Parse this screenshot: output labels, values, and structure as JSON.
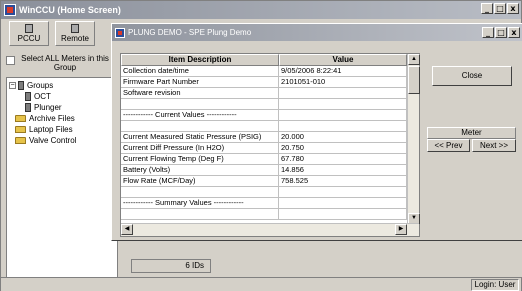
{
  "main_window": {
    "title": "WinCCU  (Home Screen)",
    "min": "_",
    "max": "□",
    "close": "x"
  },
  "toolbar": {
    "pccu_label": "PCCU",
    "remote_label": "Remote"
  },
  "select_all": {
    "label": "Select ALL Meters in this Group"
  },
  "tree": {
    "groups": "Groups",
    "oct": "OCT",
    "plunger": "Plunger",
    "archive": "Archive Files",
    "laptop": "Laptop Files",
    "valve": "Valve Control"
  },
  "child_window": {
    "title": "PLUNG DEMO - SPE Plung Demo",
    "min": "_",
    "max": "□",
    "close": "x"
  },
  "grid": {
    "headers": [
      "Item Description",
      "Value"
    ],
    "rows": [
      [
        "Collection date/time",
        "9/05/2006  8:22:41"
      ],
      [
        "Firmware Part Number",
        "2101051-010"
      ],
      [
        "Software revision",
        ""
      ],
      [
        "",
        ""
      ],
      [
        "------------ Current Values ------------",
        ""
      ],
      [
        "",
        ""
      ],
      [
        "Current Measured Static Pressure (PSIG)",
        "20.000"
      ],
      [
        "Current Diff Pressure (In H2O)",
        "20.750"
      ],
      [
        "Current Flowing Temp (Deg F)",
        "67.780"
      ],
      [
        "Battery (Volts)",
        "14.856"
      ],
      [
        "Flow Rate (MCF/Day)",
        "758.525"
      ],
      [
        "",
        ""
      ],
      [
        "------------ Summary Values ------------",
        ""
      ],
      [
        "",
        ""
      ]
    ]
  },
  "buttons": {
    "close": "Close",
    "meter": "Meter",
    "prev": "<< Prev",
    "next": "Next >>"
  },
  "status": {
    "ids": "6 IDs",
    "login": "Login: User"
  }
}
